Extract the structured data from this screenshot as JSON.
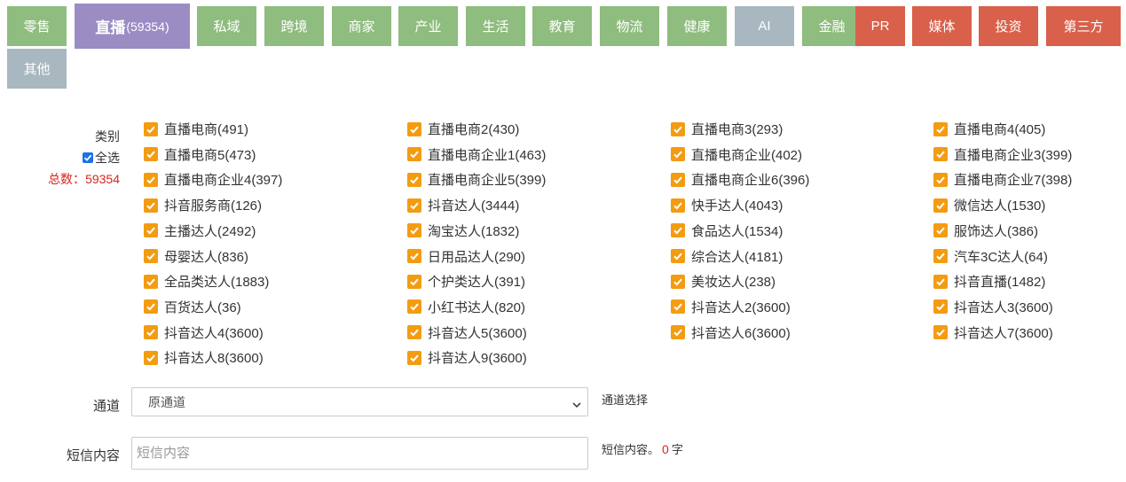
{
  "tabs": [
    {
      "label": "零售",
      "color": "#8fbc7f"
    },
    {
      "label": "直播",
      "count": "(59354)",
      "color": "#9b8cc4",
      "active": true
    },
    {
      "label": "私域",
      "color": "#8fbc7f"
    },
    {
      "label": "跨境",
      "color": "#8fbc7f"
    },
    {
      "label": "商家",
      "color": "#8fbc7f"
    },
    {
      "label": "产业",
      "color": "#8fbc7f"
    },
    {
      "label": "生活",
      "color": "#8fbc7f"
    },
    {
      "label": "教育",
      "color": "#8fbc7f"
    },
    {
      "label": "物流",
      "color": "#8fbc7f"
    },
    {
      "label": "健康",
      "color": "#8fbc7f"
    },
    {
      "label": "AI",
      "color": "#a9b7c0"
    },
    {
      "label": "金融",
      "color": "#8fbc7f"
    },
    {
      "label": "PR",
      "color": "#d9604a"
    },
    {
      "label": "媒体",
      "color": "#d9604a"
    },
    {
      "label": "投资",
      "color": "#d9604a"
    },
    {
      "label": "第三方",
      "color": "#d9604a"
    },
    {
      "label": "其他",
      "color": "#a9b7c0"
    }
  ],
  "category": {
    "label": "类别",
    "select_all": "全选",
    "total_prefix": "总数：",
    "total_value": "59354",
    "checkbox_color": "#f39c12",
    "items": [
      "直播电商(491)",
      "直播电商2(430)",
      "直播电商3(293)",
      "直播电商4(405)",
      "直播电商5(473)",
      "直播电商企业1(463)",
      "直播电商企业(402)",
      "直播电商企业3(399)",
      "直播电商企业4(397)",
      "直播电商企业5(399)",
      "直播电商企业6(396)",
      "直播电商企业7(398)",
      "抖音服务商(126)",
      "抖音达人(3444)",
      "快手达人(4043)",
      "微信达人(1530)",
      "主播达人(2492)",
      "淘宝达人(1832)",
      "食品达人(1534)",
      "服饰达人(386)",
      "母婴达人(836)",
      "日用品达人(290)",
      "综合达人(4181)",
      "汽车3C达人(64)",
      "全品类达人(1883)",
      "个护类达人(391)",
      "美妆达人(238)",
      "抖音直播(1482)",
      "百货达人(36)",
      "小红书达人(820)",
      "抖音达人2(3600)",
      "抖音达人3(3600)",
      "抖音达人4(3600)",
      "抖音达人5(3600)",
      "抖音达人6(3600)",
      "抖音达人7(3600)",
      "抖音达人8(3600)",
      "抖音达人9(3600)"
    ]
  },
  "channel": {
    "label": "通道",
    "value": "原通道",
    "hint": "通道选择"
  },
  "sms": {
    "label": "短信内容",
    "placeholder": "短信内容",
    "hint_prefix": "短信内容。",
    "count": "0",
    "hint_suffix": "字"
  }
}
